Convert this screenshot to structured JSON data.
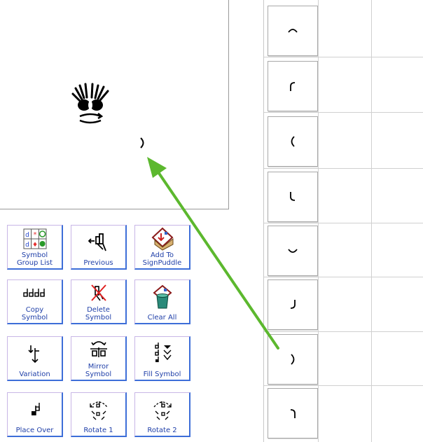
{
  "toolbar": {
    "buttons": [
      {
        "name": "symbol-group-list-button",
        "label": "Symbol\nGroup List"
      },
      {
        "name": "previous-button",
        "label": "Previous"
      },
      {
        "name": "add-to-signpuddle-button",
        "label": "Add To\nSignPuddle"
      },
      {
        "name": "copy-symbol-button",
        "label": "Copy\nSymbol"
      },
      {
        "name": "delete-symbol-button",
        "label": "Delete\nSymbol"
      },
      {
        "name": "clear-all-button",
        "label": "Clear All"
      },
      {
        "name": "variation-button",
        "label": "Variation"
      },
      {
        "name": "mirror-symbol-button",
        "label": "Mirror\nSymbol"
      },
      {
        "name": "fill-symbol-button",
        "label": "Fill Symbol"
      },
      {
        "name": "place-over-button",
        "label": "Place Over"
      },
      {
        "name": "rotate-1-button",
        "label": "Rotate 1"
      },
      {
        "name": "rotate-2-button",
        "label": "Rotate 2"
      }
    ]
  },
  "palette": {
    "symbols": [
      "arc-top-icon",
      "arc-top-left-icon",
      "arc-left-icon",
      "arc-bottom-left-icon",
      "arc-bottom-icon",
      "arc-bottom-right-icon",
      "arc-right-icon",
      "arc-top-right-icon"
    ]
  },
  "colors": {
    "arrow": "#5cb82e",
    "button_border": "#3d6ed8",
    "button_label": "#1f3fa8"
  }
}
